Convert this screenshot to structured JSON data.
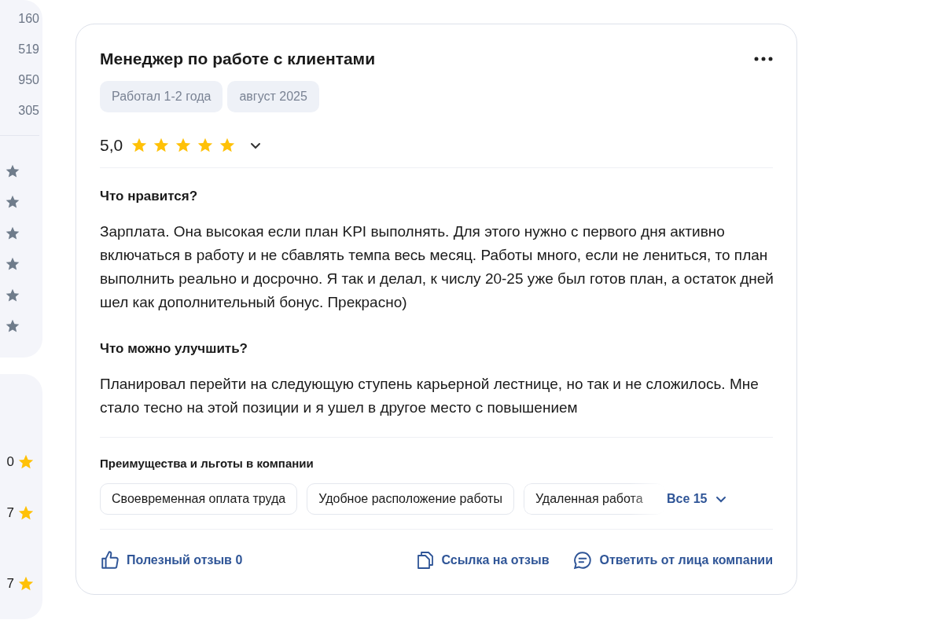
{
  "sidebar": {
    "counts": [
      "160",
      "519",
      "950",
      "305"
    ],
    "rating_rows": [
      {
        "value": "0"
      },
      {
        "value": "7"
      },
      {
        "value": "7"
      }
    ]
  },
  "review": {
    "title": "Менеджер по работе с клиентами",
    "tags": [
      "Работал 1-2 года",
      "август 2025"
    ],
    "rating": "5,0",
    "stars": 5,
    "sections": [
      {
        "heading": "Что нравится?",
        "text": "Зарплата. Она высокая если план KPI выполнять. Для этого нужно с первого дня активно включаться в работу и не сбавлять темпа весь месяц. Работы много, если не лениться, то план выполнить реально и досрочно. Я так и делал, к числу 20-25 уже был готов план, а остаток дней шел как дополнительный бонус. Прекрасно)"
      },
      {
        "heading": "Что можно улучшить?",
        "text": "Планировал перейти на следующую ступень карьерной лестнице, но так и не сложилось. Мне стало тесно на этой позиции и я ушел в другое место с повышением"
      }
    ],
    "benefits_title": "Преимущества и льготы в компании",
    "benefits": [
      "Своевременная оплата труда",
      "Удобное расположение работы",
      "Удаленная работа"
    ],
    "benefits_all": "Все 15",
    "actions": [
      {
        "kind": "like",
        "label": "Полезный отзыв 0"
      },
      {
        "kind": "link",
        "label": "Ссылка на отзыв"
      },
      {
        "kind": "reply",
        "label": "Ответить от лица компании"
      }
    ]
  }
}
